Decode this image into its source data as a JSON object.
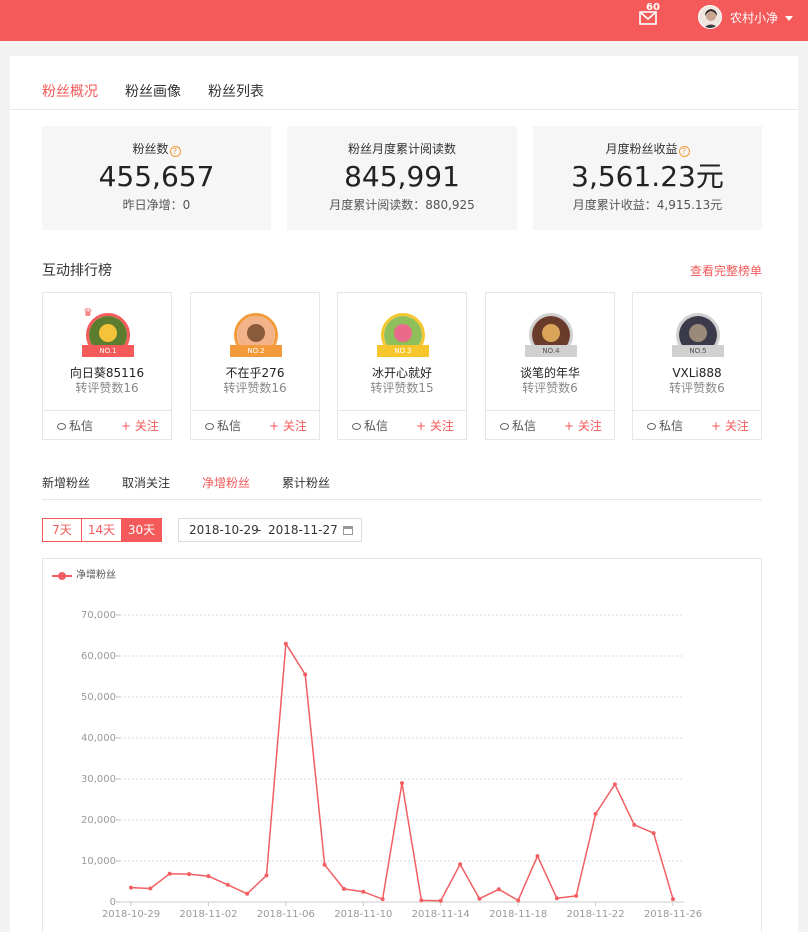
{
  "header": {
    "mail_count": "60",
    "username": "农村小净",
    "colors": {
      "brand": "#f45a5a"
    }
  },
  "tabs": [
    {
      "label": "粉丝概况",
      "active": true
    },
    {
      "label": "粉丝画像",
      "active": false
    },
    {
      "label": "粉丝列表",
      "active": false
    }
  ],
  "stats": [
    {
      "label": "粉丝数",
      "value": "455,657",
      "sub": "昨日净增：0",
      "help_icon": true
    },
    {
      "label": "粉丝月度累计阅读数",
      "value": "845,991",
      "sub": "月度累计阅读数：880,925",
      "help_icon": false
    },
    {
      "label": "月度粉丝收益",
      "value": "3,561.23元",
      "sub": "月度累计收益：4,915.13元",
      "help_icon": true
    }
  ],
  "ranking": {
    "title": "互动排行榜",
    "link": "查看完整榜单",
    "message_label": "私信",
    "follow_label": "+ 关注",
    "cards": [
      {
        "rank": "NO.1",
        "name": "向日葵85116",
        "score": "转评赞数16",
        "ribbon": "#f45a5a"
      },
      {
        "rank": "NO.2",
        "name": "不在乎276",
        "score": "转评赞数16",
        "ribbon": "#f39a3b"
      },
      {
        "rank": "NO.3",
        "name": "冰开心就好",
        "score": "转评赞数15",
        "ribbon": "#f7c62f"
      },
      {
        "rank": "NO.4",
        "name": "谈笔的年华",
        "score": "转评赞数6",
        "ribbon": "#d0d0d0"
      },
      {
        "rank": "NO.5",
        "name": "VXLi888",
        "score": "转评赞数6",
        "ribbon": "#d0d0d0"
      }
    ]
  },
  "subtabs": [
    {
      "label": "新增粉丝",
      "active": false
    },
    {
      "label": "取消关注",
      "active": false
    },
    {
      "label": "净增粉丝",
      "active": true
    },
    {
      "label": "累计粉丝",
      "active": false
    }
  ],
  "ranges": [
    {
      "label": "7天",
      "active": false
    },
    {
      "label": "14天",
      "active": false
    },
    {
      "label": "30天",
      "active": true
    }
  ],
  "date_range": {
    "start": "2018-10-29",
    "separator": "-",
    "end": "2018-11-27"
  },
  "chart_data": {
    "type": "line",
    "legend": "净增粉丝",
    "x": [
      "2018-10-29",
      "2018-10-30",
      "2018-10-31",
      "2018-11-01",
      "2018-11-02",
      "2018-11-03",
      "2018-11-04",
      "2018-11-05",
      "2018-11-06",
      "2018-11-07",
      "2018-11-08",
      "2018-11-09",
      "2018-11-10",
      "2018-11-11",
      "2018-11-12",
      "2018-11-13",
      "2018-11-14",
      "2018-11-15",
      "2018-11-16",
      "2018-11-17",
      "2018-11-18",
      "2018-11-19",
      "2018-11-20",
      "2018-11-21",
      "2018-11-22",
      "2018-11-23",
      "2018-11-24",
      "2018-11-25",
      "2018-11-26"
    ],
    "x_tick_labels": [
      "2018-10-29",
      "2018-11-02",
      "2018-11-06",
      "2018-11-10",
      "2018-11-14",
      "2018-11-18",
      "2018-11-22",
      "2018-11-26"
    ],
    "series": [
      {
        "name": "净增粉丝",
        "color": "#f25f63",
        "values": [
          3500,
          3300,
          6900,
          6800,
          6300,
          4200,
          2000,
          6500,
          63000,
          55500,
          9100,
          3200,
          2500,
          700,
          29000,
          400,
          300,
          9200,
          800,
          3100,
          400,
          11200,
          900,
          1500,
          21500,
          28700,
          18800,
          16800,
          700
        ]
      }
    ],
    "ylim": [
      0,
      70000
    ],
    "y_ticks": [
      0,
      10000,
      20000,
      30000,
      40000,
      50000,
      60000,
      70000
    ],
    "y_tick_labels": [
      "0",
      "10,000",
      "20,000",
      "30,000",
      "40,000",
      "50,000",
      "60,000",
      "70,000"
    ],
    "grid": true,
    "legend_position": "top-left"
  }
}
